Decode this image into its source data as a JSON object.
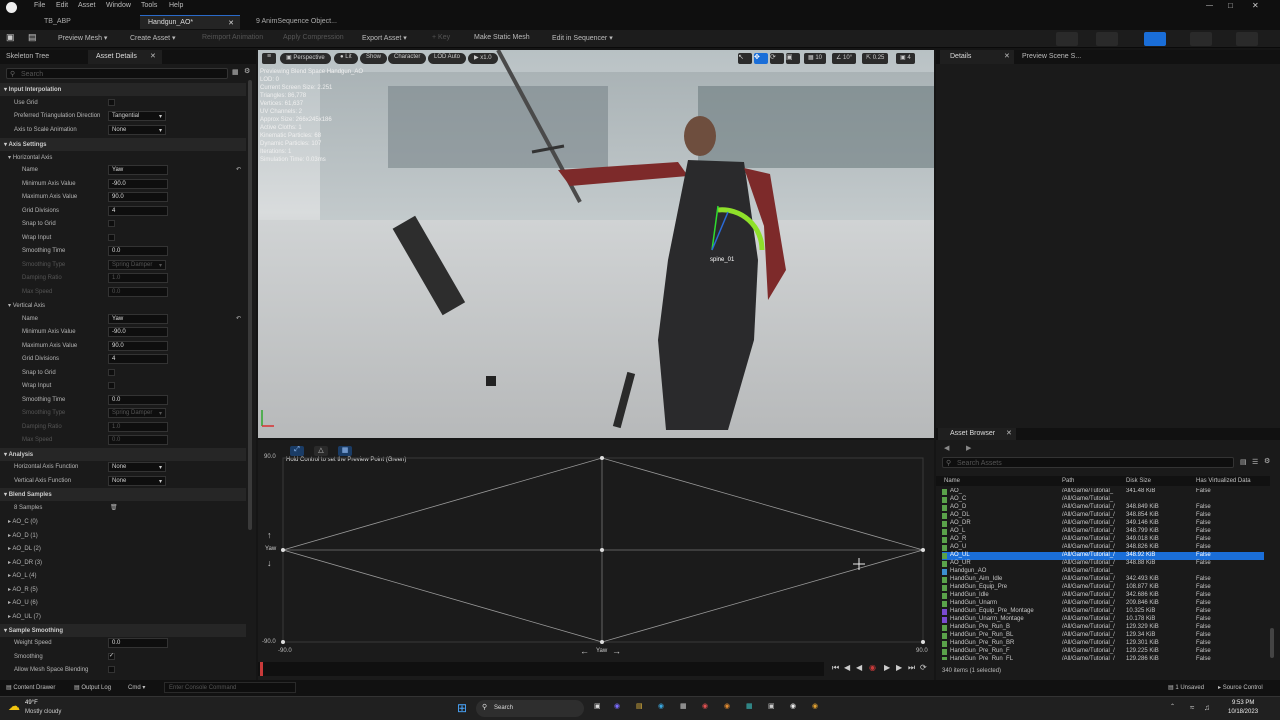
{
  "menubar": {
    "items": [
      "File",
      "Edit",
      "Asset",
      "Window",
      "Tools",
      "Help"
    ]
  },
  "tabs": [
    {
      "label": "TB_ABP"
    },
    {
      "label": "Handgun_AO*"
    },
    {
      "label": "9 AnimSequence Object..."
    }
  ],
  "toolbar": {
    "preview_mesh": "Preview Mesh",
    "create_asset": "Create Asset",
    "reimport": "Reimport Animation",
    "apply_compression": "Apply Compression",
    "export_asset": "Export Asset",
    "key": "Key",
    "make_static_mesh": "Make Static Mesh",
    "edit_in_sequencer": "Edit in Sequencer"
  },
  "left_tabs": {
    "skeleton_tree": "Skeleton Tree",
    "asset_details": "Asset Details"
  },
  "left_search_placeholder": "Search",
  "details": {
    "input_interpolation": "Input Interpolation",
    "use_grid": "Use Grid",
    "preferred_triangulation": "Preferred Triangulation Direction",
    "preferred_triangulation_value": "Tangential",
    "axis_to_scale": "Axis to Scale Animation",
    "axis_to_scale_value": "None",
    "axis_settings": "Axis Settings",
    "horizontal_axis": "Horizontal Axis",
    "vertical_axis": "Vertical Axis",
    "name": "Name",
    "min_axis": "Minimum Axis Value",
    "max_axis": "Maximum Axis Value",
    "grid_divisions": "Grid Divisions",
    "snap_to_grid": "Snap to Grid",
    "wrap_input": "Wrap Input",
    "smoothing_time": "Smoothing Time",
    "smoothing_type": "Smoothing Type",
    "damping_ratio": "Damping Ratio",
    "max_speed": "Max Speed",
    "h_name": "Yaw",
    "h_min": "-90.0",
    "h_max": "90.0",
    "h_grid": "4",
    "h_smooth": "0.0",
    "h_stype": "Spring Damper",
    "h_damp": "1.0",
    "h_speed": "0.0",
    "v_name": "Yaw",
    "v_min": "-90.0",
    "v_max": "90.0",
    "v_grid": "4",
    "v_smooth": "0.0",
    "v_stype": "Spring Damper",
    "v_damp": "1.0",
    "v_speed": "0.0",
    "analysis": "Analysis",
    "h_axis_func": "Horizontal Axis Function",
    "v_axis_func": "Vertical Axis Function",
    "func_value": "None",
    "blend_samples": "Blend Samples",
    "sample_count": "8 Samples",
    "samples": [
      "AO_C (0)",
      "AO_D (1)",
      "AO_DL (2)",
      "AO_DR (3)",
      "AO_L (4)",
      "AO_R (5)",
      "AO_U (6)",
      "AO_UL (7)"
    ],
    "sample_smoothing": "Sample Smoothing",
    "weight_speed": "Weight Speed",
    "weight_speed_value": "0.0",
    "smoothing": "Smoothing",
    "allow_mesh": "Allow Mesh Space Blending"
  },
  "viewport": {
    "perspective": "Perspective",
    "lit": "Lit",
    "show": "Show",
    "character": "Character",
    "lod": "LOD Auto",
    "speed": "x1.0",
    "grid_snap": "10",
    "rot_snap": "10°",
    "scale_snap": "0.25",
    "cam_speed": "4",
    "stats": [
      "Previewing Blend Space Handgun_AO",
      "LOD: 0",
      "Current Screen Size: 2.251",
      "Triangles: 86,778",
      "Vertices: 61,637",
      "UV Channels: 2",
      "Approx Size: 266x245x186",
      "Active Cloths: 1",
      "Kinematic Particles: 68",
      "Dynamic Particles: 107",
      "Iterations: 1",
      "Simulation Time: 0.03ms"
    ],
    "bone_label": "spine_01"
  },
  "blendspace": {
    "hint": "Hold Control to set the Preview Point (Green)",
    "y_max": "90.0",
    "y_min": "-90.0",
    "x_min": "-90.0",
    "x_max": "90.0",
    "x_label": "Yaw",
    "y_label": "Yaw"
  },
  "right_tabs": {
    "details": "Details",
    "preview_scene": "Preview Scene S..."
  },
  "asset_browser": {
    "tab": "Asset Browser",
    "search_placeholder": "Search Assets",
    "columns": [
      "Name",
      "Path",
      "Disk Size",
      "Has Virtualized Data"
    ],
    "rows": [
      {
        "name": "AO_",
        "path": "/All/Game/Tutorial_",
        "size": "341.48 KiB",
        "virt": "False",
        "color": "#5aa24a"
      },
      {
        "name": "AO_C",
        "path": "/All/Game/Tutorial_",
        "size": "",
        "virt": "",
        "color": "#5aa24a"
      },
      {
        "name": "AO_D",
        "path": "/All/Game/Tutorial_/",
        "size": "348.849 KiB",
        "virt": "False",
        "color": "#5aa24a"
      },
      {
        "name": "AO_DL",
        "path": "/All/Game/Tutorial_/",
        "size": "348.854 KiB",
        "virt": "False",
        "color": "#5aa24a"
      },
      {
        "name": "AO_DR",
        "path": "/All/Game/Tutorial_/",
        "size": "349.146 KiB",
        "virt": "False",
        "color": "#5aa24a"
      },
      {
        "name": "AO_L",
        "path": "/All/Game/Tutorial_/",
        "size": "348.799 KiB",
        "virt": "False",
        "color": "#5aa24a"
      },
      {
        "name": "AO_R",
        "path": "/All/Game/Tutorial_/",
        "size": "349.018 KiB",
        "virt": "False",
        "color": "#5aa24a"
      },
      {
        "name": "AO_U",
        "path": "/All/Game/Tutorial_/",
        "size": "348.826 KiB",
        "virt": "False",
        "color": "#5aa24a"
      },
      {
        "name": "AO_UL",
        "path": "/All/Game/Tutorial_/",
        "size": "348.92 KiB",
        "virt": "False",
        "color": "#5aa24a",
        "selected": true
      },
      {
        "name": "AO_UR",
        "path": "/All/Game/Tutorial_/",
        "size": "348.88 KiB",
        "virt": "False",
        "color": "#5aa24a"
      },
      {
        "name": "Handgun_AO",
        "path": "/All/Game/Tutorial_",
        "size": "",
        "virt": "",
        "color": "#3c8fd0"
      },
      {
        "name": "HandGun_Aim_Idle",
        "path": "/All/Game/Tutorial_/",
        "size": "342.493 KiB",
        "virt": "False",
        "color": "#5aa24a"
      },
      {
        "name": "HandGun_Equip_Pre",
        "path": "/All/Game/Tutorial_/",
        "size": "108.877 KiB",
        "virt": "False",
        "color": "#5aa24a"
      },
      {
        "name": "HandGun_Idle",
        "path": "/All/Game/Tutorial_/",
        "size": "342.686 KiB",
        "virt": "False",
        "color": "#5aa24a"
      },
      {
        "name": "HandGun_Unarm",
        "path": "/All/Game/Tutorial_/",
        "size": "209.846 KiB",
        "virt": "False",
        "color": "#5aa24a"
      },
      {
        "name": "HandGun_Equip_Pre_Montage",
        "path": "/All/Game/Tutorial_/",
        "size": "10.325 KiB",
        "virt": "False",
        "color": "#7a4ad0"
      },
      {
        "name": "HandGun_Unarm_Montage",
        "path": "/All/Game/Tutorial_/",
        "size": "10.178 KiB",
        "virt": "False",
        "color": "#7a4ad0"
      },
      {
        "name": "HandGun_Pre_Run_B",
        "path": "/All/Game/Tutorial_/",
        "size": "129.329 KiB",
        "virt": "False",
        "color": "#5aa24a"
      },
      {
        "name": "HandGun_Pre_Run_BL",
        "path": "/All/Game/Tutorial_/",
        "size": "129.34 KiB",
        "virt": "False",
        "color": "#5aa24a"
      },
      {
        "name": "HandGun_Pre_Run_BR",
        "path": "/All/Game/Tutorial_/",
        "size": "129.301 KiB",
        "virt": "False",
        "color": "#5aa24a"
      },
      {
        "name": "HandGun_Pre_Run_F",
        "path": "/All/Game/Tutorial_/",
        "size": "129.225 KiB",
        "virt": "False",
        "color": "#5aa24a"
      },
      {
        "name": "HandGun_Pre_Run_FL",
        "path": "/All/Game/Tutorial_/",
        "size": "129.286 KiB",
        "virt": "False",
        "color": "#5aa24a"
      }
    ],
    "count": "340 items (1 selected)"
  },
  "statusbar": {
    "content_drawer": "Content Drawer",
    "output_log": "Output Log",
    "cmd": "Cmd",
    "console_placeholder": "Enter Console Command",
    "unsaved": "1 Unsaved",
    "source_control": "Source Control"
  },
  "taskbar": {
    "temp": "49°F",
    "weather": "Mostly cloudy",
    "search": "Search",
    "time": "9:53 PM",
    "date": "10/18/2023"
  },
  "accent_color": "#1a6ed8"
}
